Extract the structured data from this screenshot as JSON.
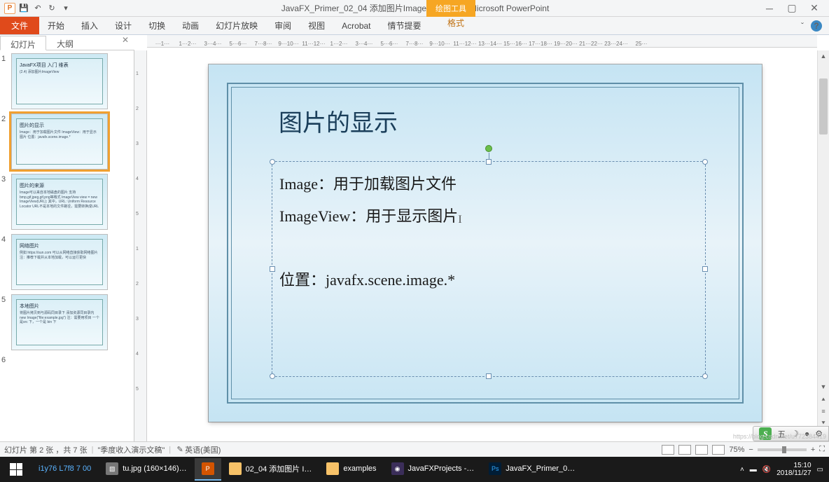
{
  "titlebar": {
    "app_icon_text": "P",
    "doc_title": "JavaFX_Primer_02_04 添加图片ImageView.pptx - Microsoft PowerPoint",
    "contextual_label": "绘图工具"
  },
  "ribbon": {
    "tabs": {
      "file": "文件",
      "home": "开始",
      "insert": "插入",
      "design": "设计",
      "transitions": "切换",
      "animations": "动画",
      "slideshow": "幻灯片放映",
      "review": "审阅",
      "view": "视图",
      "acrobat": "Acrobat",
      "storyline": "情节提要",
      "format": "格式"
    }
  },
  "panel_tabs": {
    "slides": "幻灯片",
    "outline": "大纲"
  },
  "thumbnails": [
    {
      "num": "1",
      "title": "JavaFX项目  入门  维表",
      "sub": "(2.4) 添加图片ImageView"
    },
    {
      "num": "2",
      "title": "图片的显示",
      "sub": "Image：用于加载图片文件 ImageView：用于显示图片  位置：javafx.scene.image.*"
    },
    {
      "num": "3",
      "title": "图片的来源",
      "sub": "Image可以来自本地磁盘的图片 支持bmp,gif,jpeg,gif,png等格式  ImageView view = new ImageView(URL);  其中，URL: Uniform Resource Locator URL不是本地的文件路径，需要转换成URL"
    },
    {
      "num": "4",
      "title": "网络图片",
      "sub": "例如 https://sun.com 可以从网络直接获取网络图片  注：推荐下载并从本地加载，可以运行更快"
    },
    {
      "num": "5",
      "title": "本地图片",
      "sub": "将图片拷贝到与源码同目录下 添加资源同目录内 new Image(\"file:example.jpg\")  注：需要用项目  一个是src 下，一个是 bin 下"
    },
    {
      "num": "6",
      "title": "",
      "sub": ""
    }
  ],
  "slide": {
    "title": "图片的显示",
    "line1": "Image：用于加载图片文件",
    "line2": "ImageView：用于显示图片",
    "line3": "位置：javafx.scene.image.*"
  },
  "statusbar": {
    "slide_info": "幻灯片 第 2 张 ，共 7 张",
    "template": "\"季度收入演示文稿\"",
    "lang": "英语(美国)",
    "zoom": "75%"
  },
  "ime": {
    "label_wu": "五",
    "label_moon": "",
    "label_full": ""
  },
  "taskbar": {
    "overlay": "i1y76  L7f8  7 00",
    "items": {
      "img": "tu.jpg (160×146)…",
      "folder1": "02_04 添加图片 I…",
      "folder2": "examples",
      "eclipse": "JavaFXProjects -…",
      "ps": "JavaFX_Primer_0…"
    },
    "clock_time": "15:10",
    "clock_date": "2018/11/27",
    "watermark": "https://blog.csdn.net/u772384419"
  },
  "ruler_marks": [
    "1",
    "1",
    "2",
    "3",
    "4",
    "5",
    "6",
    "7",
    "8",
    "9",
    "10",
    "11",
    "12",
    "1",
    "2",
    "3",
    "4",
    "5",
    "6",
    "7",
    "8",
    "9",
    "10",
    "11",
    "12",
    "13",
    "14",
    "15",
    "16",
    "17",
    "18",
    "19",
    "20",
    "21",
    "22",
    "23",
    "24",
    "25"
  ]
}
